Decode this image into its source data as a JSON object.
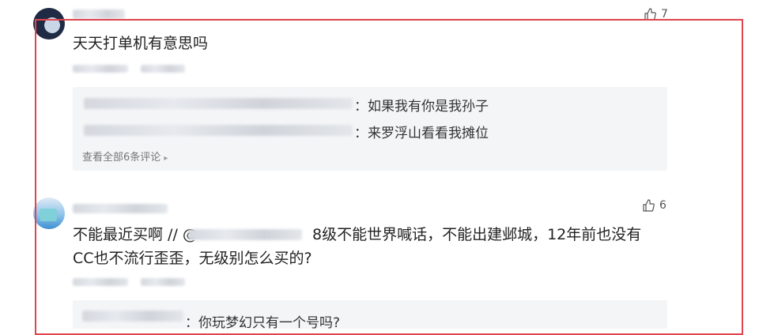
{
  "comments": [
    {
      "likes": "7",
      "text": "天天打单机有意思吗",
      "replies": [
        {
          "text": "：如果我有你是我孙子"
        },
        {
          "text": "：来罗浮山看看我摊位"
        }
      ],
      "view_all": "查看全部6条评论"
    },
    {
      "likes": "6",
      "text_line1_a": "不能最近买啊 // @",
      "text_line1_b": "8级不能世界喊话，不能出建邺城，12年前也没有",
      "text_line2": "CC也不流行歪歪，无级别怎么买的?",
      "replies": [
        {
          "text": "：你玩梦幻只有一个号吗?"
        }
      ]
    }
  ],
  "icons": {
    "like": "thumbs-up-icon",
    "chevron": "chevron-right-icon"
  },
  "colors": {
    "frame": "#e0444d",
    "reply_bg": "#f4f5f7"
  }
}
